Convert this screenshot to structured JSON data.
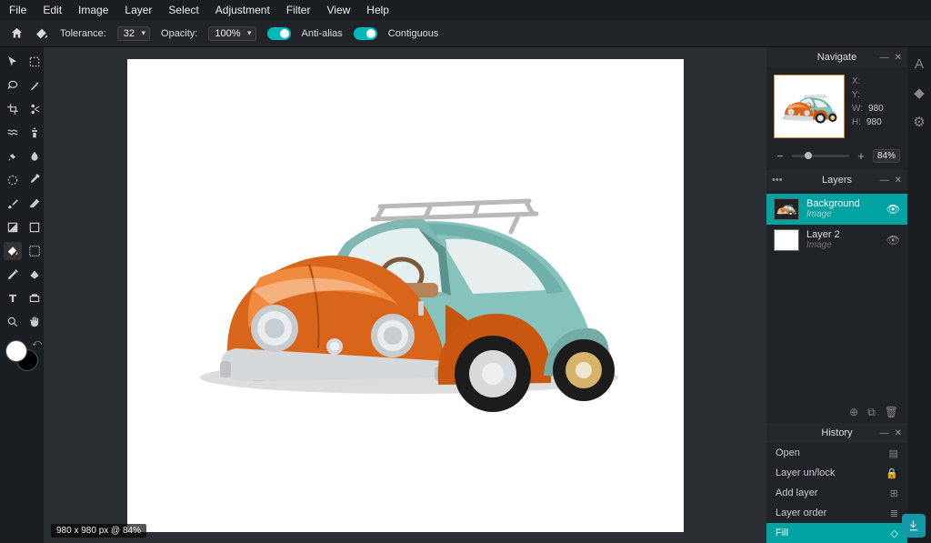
{
  "menu": [
    "File",
    "Edit",
    "Image",
    "Layer",
    "Select",
    "Adjustment",
    "Filter",
    "View",
    "Help"
  ],
  "options": {
    "tolerance_label": "Tolerance:",
    "tolerance_value": "32",
    "opacity_label": "Opacity:",
    "opacity_value": "100%",
    "antialias": "Anti-alias",
    "contiguous": "Contiguous"
  },
  "tools": [
    "move",
    "marquee",
    "lasso",
    "wand",
    "crop",
    "cutout",
    "liquify",
    "clone",
    "heal",
    "blur",
    "replace-color",
    "eyedropper",
    "brush",
    "eraser",
    "gradient",
    "shape",
    "fill",
    "draw",
    "pen",
    "sponge",
    "text",
    "hand",
    "zoom",
    "pan"
  ],
  "canvas": {
    "status": "980 x 980 px @ 84%"
  },
  "navigate": {
    "title": "Navigate",
    "x_label": "X:",
    "x_value": "",
    "y_label": "Y:",
    "y_value": "",
    "w_label": "W:",
    "w_value": "980",
    "h_label": "H:",
    "h_value": "980",
    "zoom": "84%"
  },
  "layers": {
    "title": "Layers",
    "items": [
      {
        "name": "Background",
        "type": "Image",
        "selected": true,
        "thumb": "car"
      },
      {
        "name": "Layer 2",
        "type": "Image",
        "selected": false,
        "thumb": "white"
      }
    ]
  },
  "history": {
    "title": "History",
    "items": [
      {
        "label": "Open",
        "icon": "page"
      },
      {
        "label": "Layer un/lock",
        "icon": "lock"
      },
      {
        "label": "Add layer",
        "icon": "plus-square"
      },
      {
        "label": "Layer order",
        "icon": "stack"
      },
      {
        "label": "Fill",
        "icon": "bucket",
        "active": true
      }
    ]
  },
  "colors": {
    "accent": "#00a2a2",
    "highlight_border": "#d98a2b",
    "car_orange": "#d9651a",
    "car_teal": "#86c3bd"
  }
}
